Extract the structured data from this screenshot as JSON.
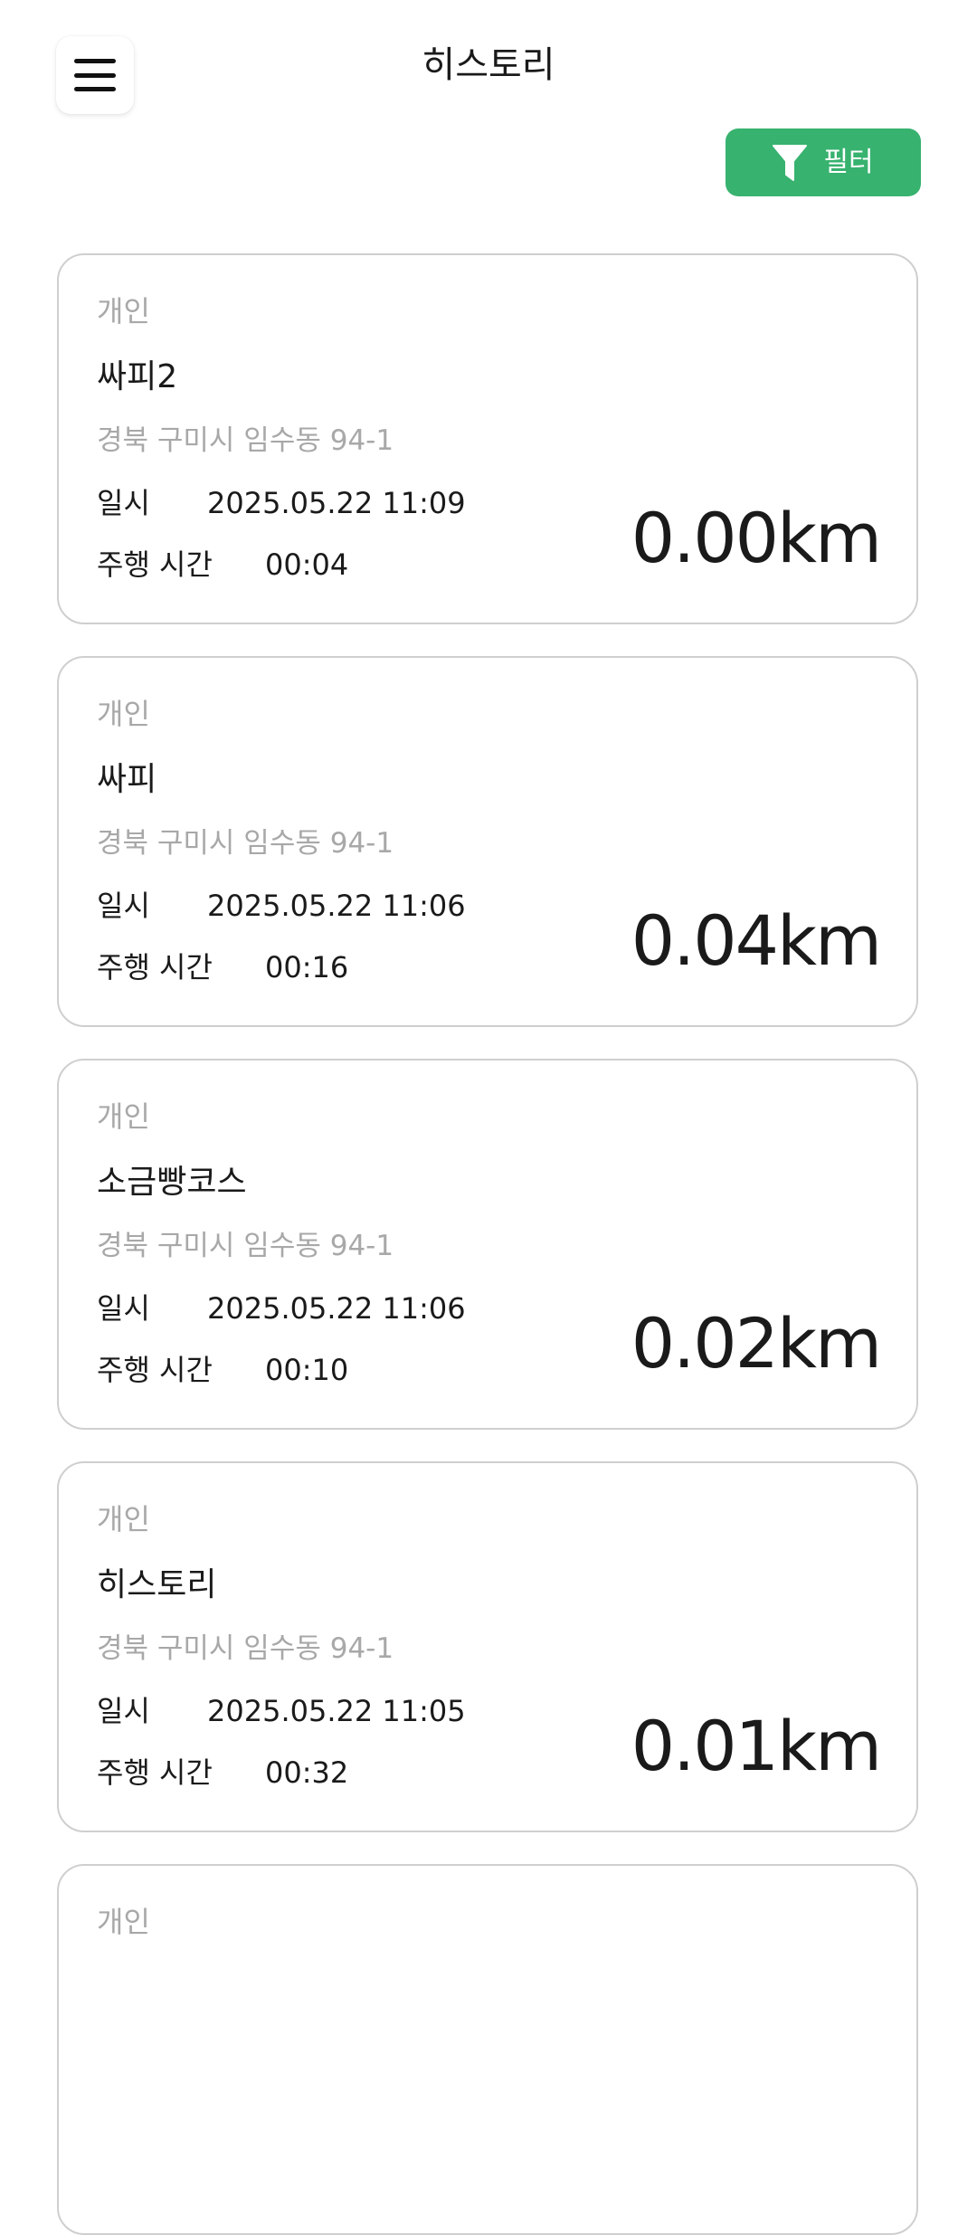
{
  "header": {
    "title": "히스토리",
    "menu_icon": "hamburger-menu-icon"
  },
  "filter": {
    "label": "필터",
    "icon": "funnel-icon",
    "color": "#37b26f"
  },
  "history": {
    "date_label": "일시",
    "time_label": "주행 시간",
    "items": [
      {
        "type": "개인",
        "name": "싸피2",
        "address": "경북 구미시 임수동 94-1",
        "date": "2025.05.22 11:09",
        "duration": "00:04",
        "distance": "0.00km"
      },
      {
        "type": "개인",
        "name": "싸피",
        "address": "경북 구미시 임수동 94-1",
        "date": "2025.05.22 11:06",
        "duration": "00:16",
        "distance": "0.04km"
      },
      {
        "type": "개인",
        "name": "소금빵코스",
        "address": "경북 구미시 임수동 94-1",
        "date": "2025.05.22 11:06",
        "duration": "00:10",
        "distance": "0.02km"
      },
      {
        "type": "개인",
        "name": "히스토리",
        "address": "경북 구미시 임수동 94-1",
        "date": "2025.05.22 11:05",
        "duration": "00:32",
        "distance": "0.01km"
      },
      {
        "type": "개인"
      }
    ]
  }
}
